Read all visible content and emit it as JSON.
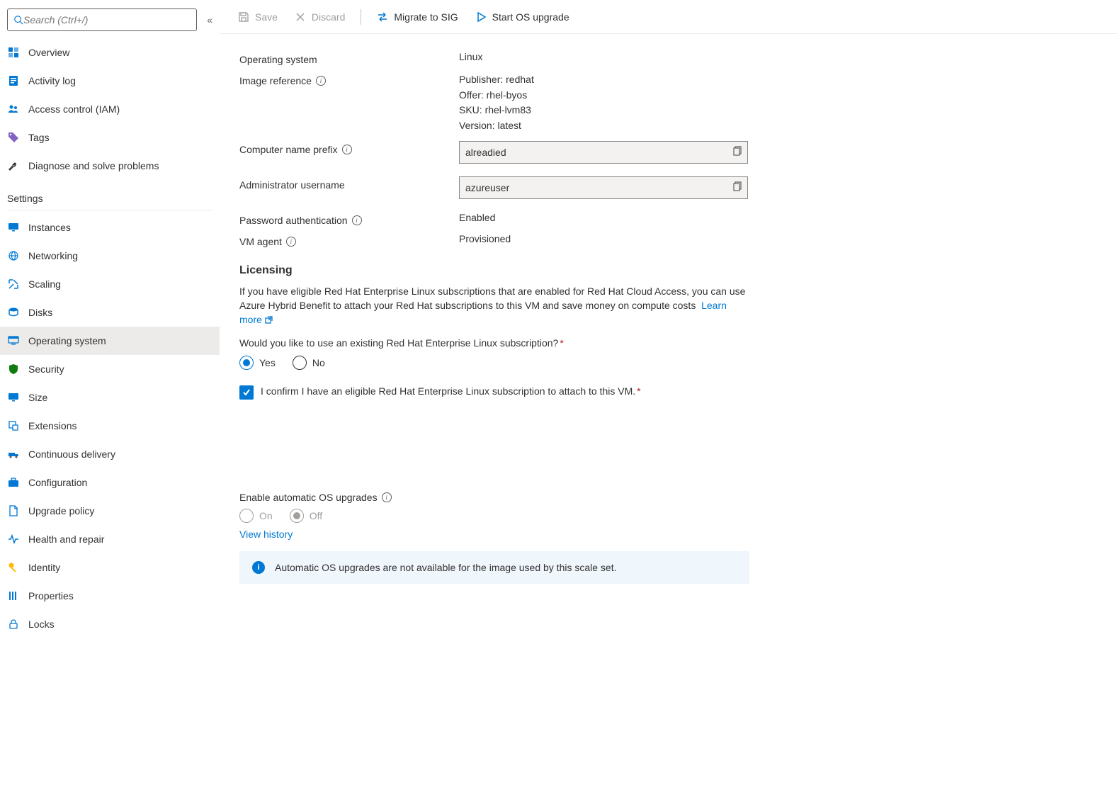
{
  "search": {
    "placeholder": "Search (Ctrl+/)"
  },
  "sidebar": {
    "overview": "Overview",
    "activity_log": "Activity log",
    "access_control": "Access control (IAM)",
    "tags": "Tags",
    "diagnose": "Diagnose and solve problems",
    "settings_header": "Settings",
    "instances": "Instances",
    "networking": "Networking",
    "scaling": "Scaling",
    "disks": "Disks",
    "operating_system": "Operating system",
    "security": "Security",
    "size": "Size",
    "extensions": "Extensions",
    "continuous_delivery": "Continuous delivery",
    "configuration": "Configuration",
    "upgrade_policy": "Upgrade policy",
    "health_repair": "Health and repair",
    "identity": "Identity",
    "properties": "Properties",
    "locks": "Locks"
  },
  "toolbar": {
    "save": "Save",
    "discard": "Discard",
    "migrate": "Migrate to SIG",
    "start_upgrade": "Start OS upgrade"
  },
  "props": {
    "os_label": "Operating system",
    "os_value": "Linux",
    "image_ref_label": "Image reference",
    "image_ref_publisher": "Publisher: redhat",
    "image_ref_offer": "Offer: rhel-byos",
    "image_ref_sku": "SKU: rhel-lvm83",
    "image_ref_version": "Version: latest",
    "computer_prefix_label": "Computer name prefix",
    "computer_prefix_value": "alreadied",
    "admin_user_label": "Administrator username",
    "admin_user_value": "azureuser",
    "password_auth_label": "Password authentication",
    "password_auth_value": "Enabled",
    "vm_agent_label": "VM agent",
    "vm_agent_value": "Provisioned"
  },
  "licensing": {
    "title": "Licensing",
    "desc": "If you have eligible Red Hat Enterprise Linux subscriptions that are enabled for Red Hat Cloud Access, you can use Azure Hybrid Benefit to attach your Red Hat subscriptions to this VM and save money on compute costs",
    "learn_more": "Learn more",
    "question": "Would you like to use an existing Red Hat Enterprise Linux subscription?",
    "yes": "Yes",
    "no": "No",
    "confirm": "I confirm I have an eligible Red Hat Enterprise Linux subscription to attach to this VM."
  },
  "upgrades": {
    "enable_label": "Enable automatic OS upgrades",
    "on": "On",
    "off": "Off",
    "view_history": "View history",
    "banner": "Automatic OS upgrades are not available for the image used by this scale set."
  }
}
